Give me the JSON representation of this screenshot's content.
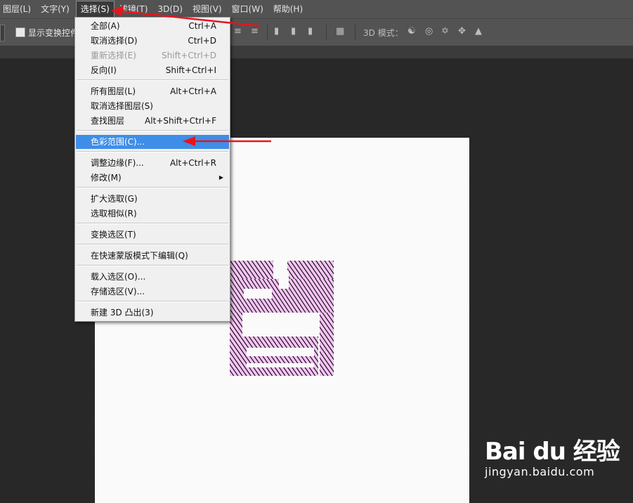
{
  "menubar": {
    "items": [
      "图层(L)",
      "文字(Y)",
      "选择(S)",
      "滤镜(T)",
      "3D(D)",
      "视图(V)",
      "窗口(W)",
      "帮助(H)"
    ],
    "active_index": 2
  },
  "optbar": {
    "checkbox_label": "显示变换控件",
    "mode_label": "3D 模式："
  },
  "menu": {
    "items": [
      {
        "label": "全部(A)",
        "shortcut": "Ctrl+A"
      },
      {
        "label": "取消选择(D)",
        "shortcut": "Ctrl+D"
      },
      {
        "label": "重新选择(E)",
        "shortcut": "Shift+Ctrl+D",
        "disabled": true
      },
      {
        "label": "反向(I)",
        "shortcut": "Shift+Ctrl+I"
      },
      {
        "label": "所有图层(L)",
        "shortcut": "Alt+Ctrl+A"
      },
      {
        "label": "取消选择图层(S)",
        "shortcut": ""
      },
      {
        "label": "查找图层",
        "shortcut": "Alt+Shift+Ctrl+F"
      },
      {
        "label": "色彩范围(C)...",
        "shortcut": "",
        "highlighted": true
      },
      {
        "label": "调整边缘(F)...",
        "shortcut": "Alt+Ctrl+R"
      },
      {
        "label": "修改(M)",
        "shortcut": "",
        "submenu": true
      },
      {
        "label": "扩大选取(G)",
        "shortcut": ""
      },
      {
        "label": "选取相似(R)",
        "shortcut": ""
      },
      {
        "label": "变换选区(T)",
        "shortcut": ""
      },
      {
        "label": "在快速蒙版模式下编辑(Q)",
        "shortcut": ""
      },
      {
        "label": "载入选区(O)...",
        "shortcut": ""
      },
      {
        "label": "存储选区(V)...",
        "shortcut": ""
      },
      {
        "label": "新建 3D 凸出(3)",
        "shortcut": ""
      }
    ]
  },
  "watermark": {
    "logo_text": "Bai du 经验",
    "url": "jingyan.baidu.com"
  },
  "colors": {
    "highlight": "#3e8ee8",
    "arrow": "#e8141c",
    "selection": "#f0b0f0"
  }
}
